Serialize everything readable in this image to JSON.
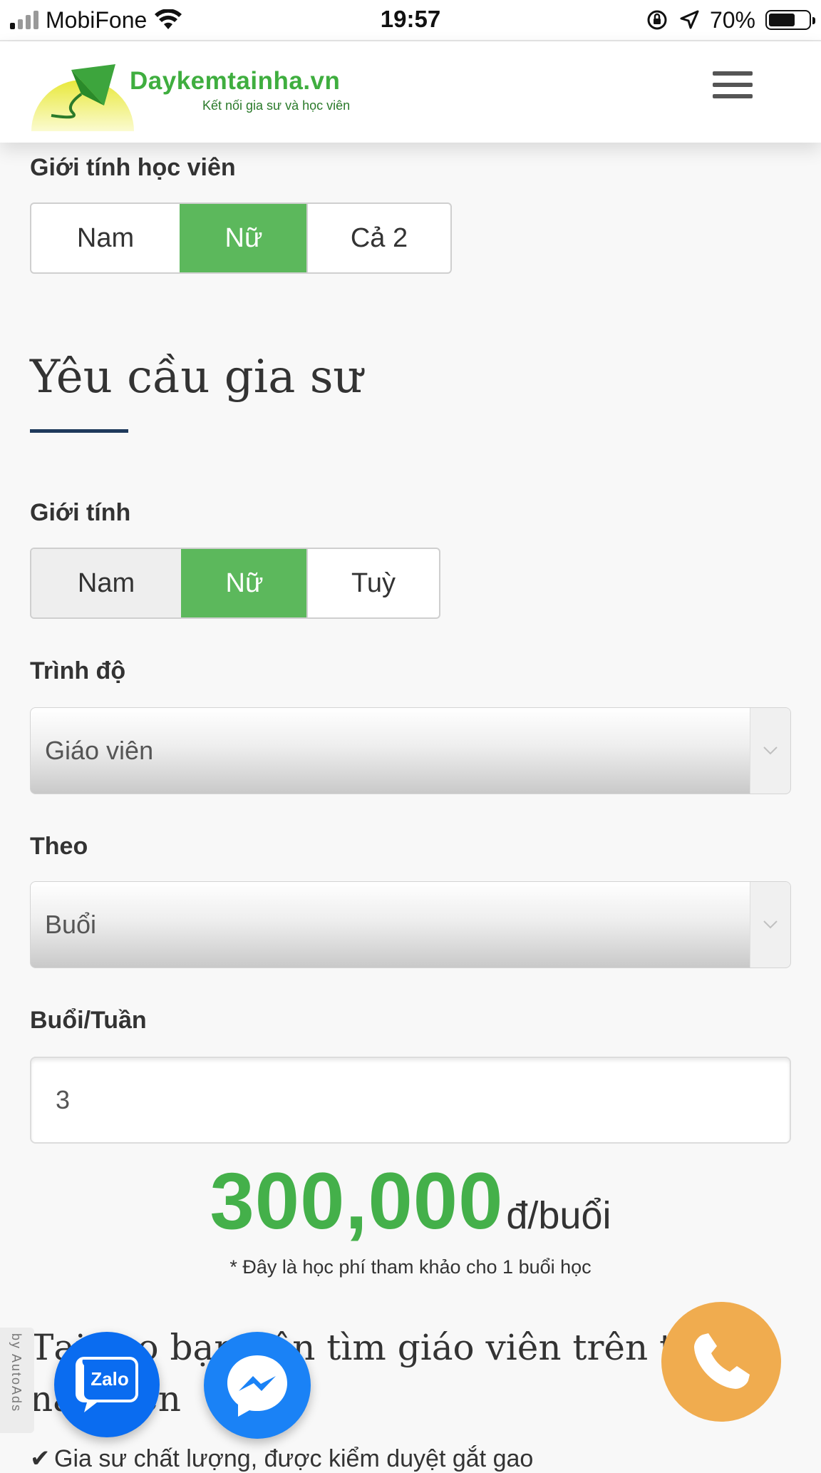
{
  "status_bar": {
    "carrier": "MobiFone",
    "time": "19:57",
    "battery": "70%",
    "battery_level": 0.7
  },
  "header": {
    "site_name": "Daykemtainha.vn",
    "tagline": "Kết nối gia sư và học viên"
  },
  "student_gender": {
    "label": "Giới tính học viên",
    "options": [
      "Nam",
      "Nữ",
      "Cả 2"
    ],
    "selected": "Nữ"
  },
  "tutor_requirements": {
    "title": "Yêu cầu gia sư",
    "gender": {
      "label": "Giới tính",
      "options": [
        "Nam",
        "Nữ",
        "Tuỳ"
      ],
      "selected": "Nữ"
    },
    "level": {
      "label": "Trình độ",
      "value": "Giáo viên"
    },
    "by": {
      "label": "Theo",
      "value": "Buổi"
    },
    "sessions": {
      "label": "Buổi/Tuần",
      "value": "3"
    }
  },
  "price": {
    "amount": "300,000",
    "unit": "đ/buổi",
    "note": "* Đây là học phí tham khảo cho 1 buổi học"
  },
  "bottom": {
    "heading": "Tại sao bạn nên tìm giáo viên trên trang này trên",
    "bullet": "Gia sư chất lượng, được kiểm duyệt gắt gao"
  },
  "widgets": {
    "autoads": "by AutoAds",
    "zalo": "Zalo"
  },
  "colors": {
    "accent_green": "#5cb85c",
    "price_green": "#44b04a",
    "phone_orange": "#f0ac4f",
    "zalo_blue": "#0a6cf0",
    "messenger_blue": "#1a82f6",
    "rule_navy": "#1f3a5c"
  },
  "icons": [
    "cellular-signal-icon",
    "wifi-icon",
    "orientation-lock-icon",
    "location-arrow-icon",
    "battery-icon",
    "hamburger-menu-icon",
    "chevron-down-icon",
    "zalo-icon",
    "messenger-icon",
    "phone-icon",
    "checkmark-icon"
  ]
}
